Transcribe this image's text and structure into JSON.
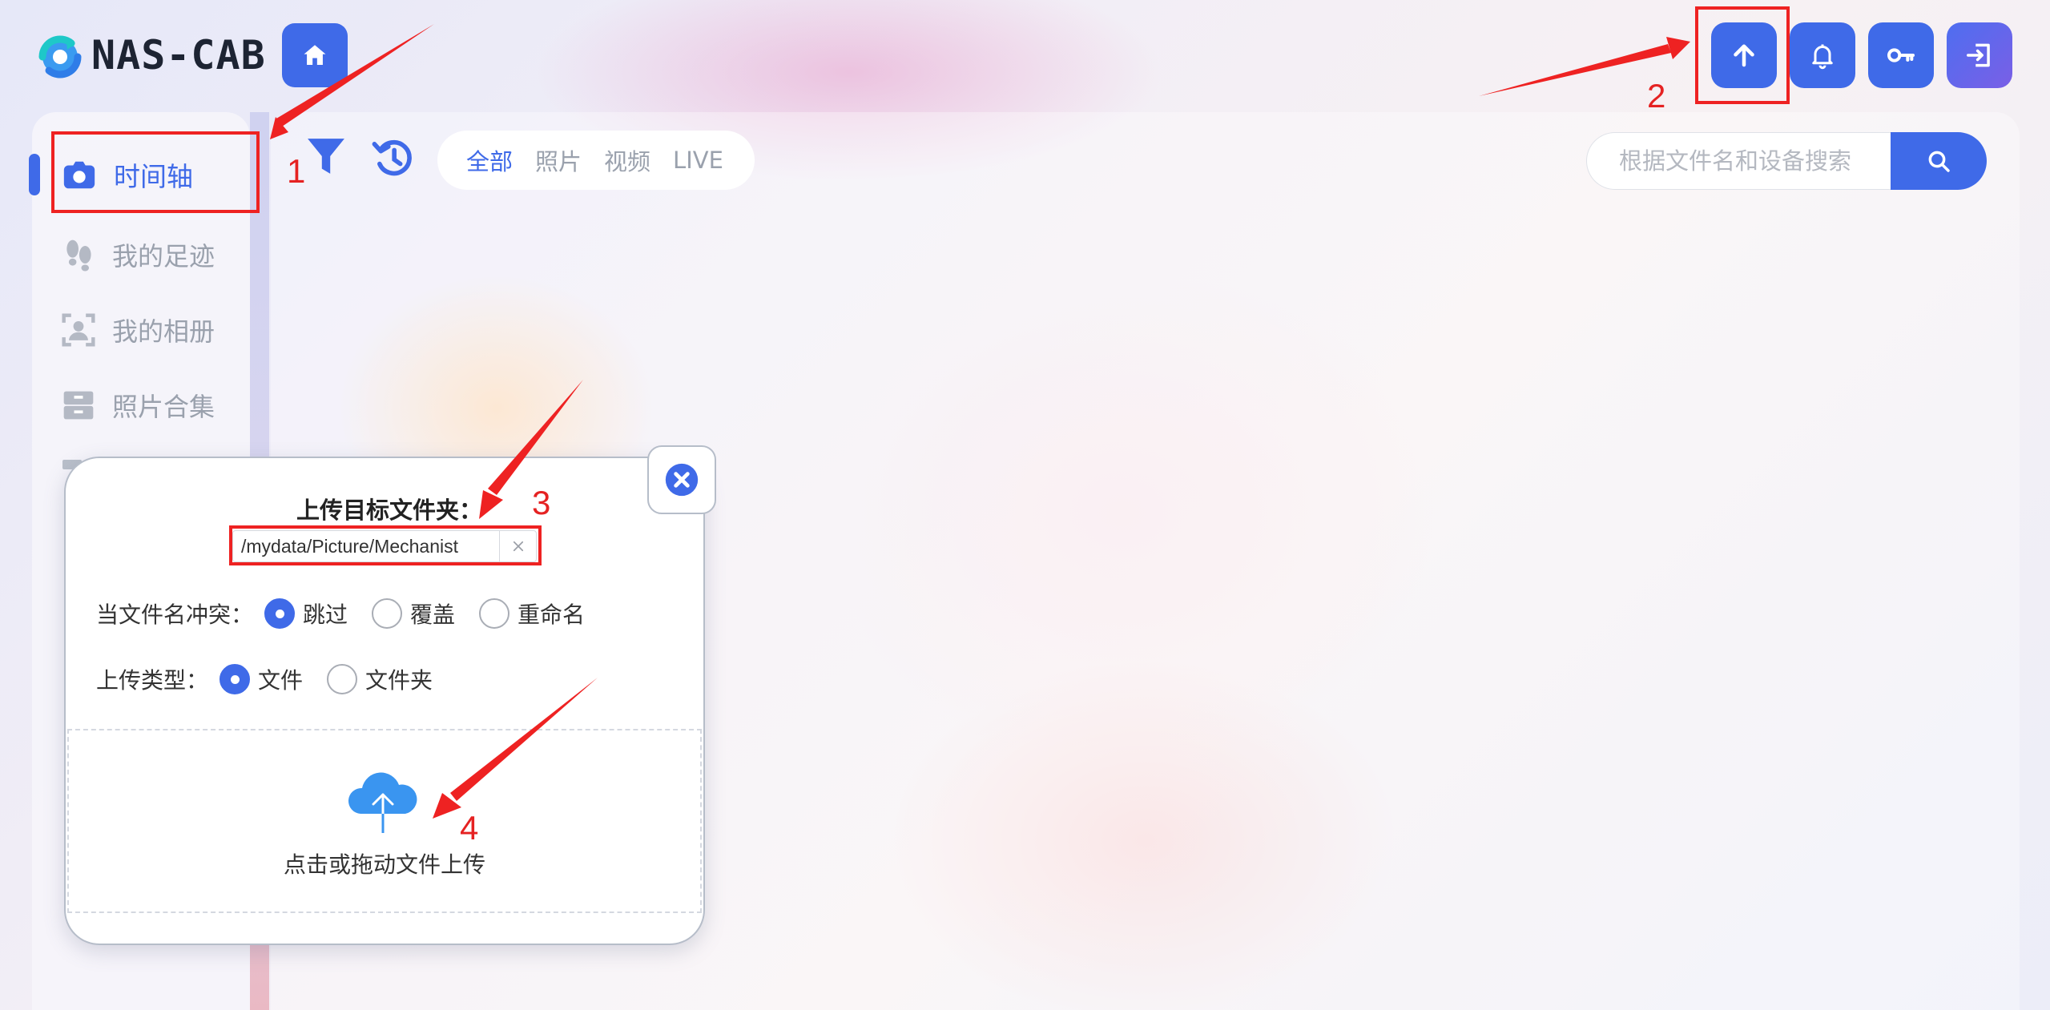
{
  "app": {
    "logo_text": "NAS-CAB"
  },
  "header": {
    "home_icon": "home-icon",
    "upload_icon": "arrow-up-icon",
    "notification_icon": "bell-icon",
    "key_icon": "key-icon",
    "logout_icon": "logout-icon"
  },
  "sidebar": {
    "items": [
      {
        "label": "时间轴",
        "icon": "camera-icon",
        "active": true
      },
      {
        "label": "我的足迹",
        "icon": "footprints-icon",
        "active": false
      },
      {
        "label": "我的相册",
        "icon": "person-album-icon",
        "active": false
      },
      {
        "label": "照片合集",
        "icon": "archive-icon",
        "active": false
      }
    ]
  },
  "toolbar": {
    "filter_icon": "funnel-icon",
    "history_icon": "history-icon",
    "tabs": [
      {
        "label": "全部",
        "active": true
      },
      {
        "label": "照片",
        "active": false
      },
      {
        "label": "视频",
        "active": false
      },
      {
        "label": "LIVE",
        "active": false
      }
    ]
  },
  "search": {
    "placeholder": "根据文件名和设备搜索",
    "value": "",
    "icon": "search-icon"
  },
  "upload_dialog": {
    "target_label": "上传目标文件夹：",
    "target_path": "/mydata/Picture/Mechanist",
    "clear_icon": "x-icon",
    "close_icon": "close-circle-icon",
    "conflict": {
      "label": "当文件名冲突：",
      "options": [
        {
          "label": "跳过",
          "checked": true
        },
        {
          "label": "覆盖",
          "checked": false
        },
        {
          "label": "重命名",
          "checked": false
        }
      ]
    },
    "upload_type": {
      "label": "上传类型：",
      "options": [
        {
          "label": "文件",
          "checked": true
        },
        {
          "label": "文件夹",
          "checked": false
        }
      ]
    },
    "drop_zone": {
      "icon": "cloud-upload-icon",
      "text": "点击或拖动文件上传"
    }
  },
  "annotations": {
    "color": "#e52222",
    "labels": [
      "1",
      "2",
      "3",
      "4"
    ]
  },
  "colors": {
    "accent": "#3f6ae8",
    "annotation_red": "#e52222"
  }
}
